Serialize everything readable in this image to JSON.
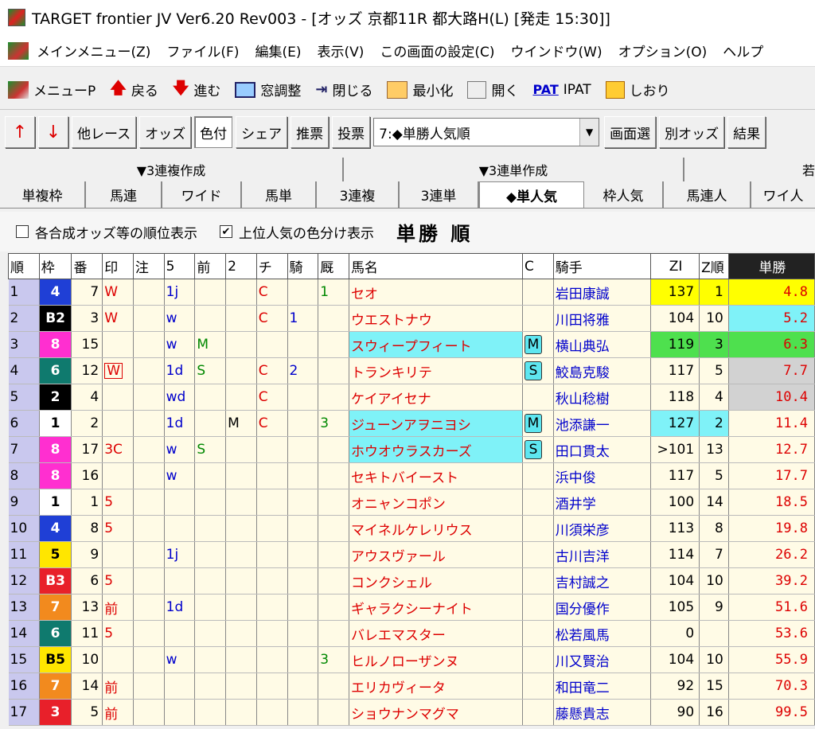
{
  "window": {
    "title": "TARGET frontier JV  Ver6.20  Rev003 - [オッズ 京都11R 都大路H(L) [発走 15:30]]"
  },
  "menu": [
    "メインメニュー(Z)",
    "ファイル(F)",
    "編集(E)",
    "表示(V)",
    "この画面の設定(C)",
    "ウインドウ(W)",
    "オプション(O)",
    "ヘルプ"
  ],
  "toolbar": {
    "items": [
      {
        "label": "メニューP",
        "icon": "menu-icon"
      },
      {
        "label": "戻る",
        "icon": "up-arrow-icon"
      },
      {
        "label": "進む",
        "icon": "down-arrow-icon"
      },
      {
        "label": "窓調整",
        "icon": "window-icon"
      },
      {
        "label": "閉じる",
        "icon": "close-icon"
      },
      {
        "label": "最小化",
        "icon": "minimize-icon"
      },
      {
        "label": "開く",
        "icon": "open-icon"
      },
      {
        "label": "IPAT",
        "icon": "pat-icon",
        "iconText": "PAT"
      },
      {
        "label": "しおり",
        "icon": "bookmark-icon"
      }
    ]
  },
  "toolbar2": {
    "up": "↑",
    "down": "↓",
    "buttons": [
      "他レース",
      "オッズ",
      "色付",
      "シェア",
      "推票",
      "投票"
    ],
    "pressed": "色付",
    "select": "7:◆単勝人気順",
    "right": [
      "画面選",
      "別オッズ",
      "結果"
    ]
  },
  "tabs_top": [
    {
      "label": "▼3連複作成"
    },
    {
      "label": "▼3連単作成"
    },
    {
      "label": "若"
    }
  ],
  "tabs": [
    "単複枠",
    "馬連",
    "ワイド",
    "馬単",
    "3連複",
    "3連単",
    "◆単人気",
    "枠人気",
    "馬連人",
    "ワイ人"
  ],
  "active_tab": "◆単人気",
  "options": {
    "rank_label": "各合成オッズ等の順位表示",
    "rank_checked": false,
    "color_label": "上位人気の色分け表示",
    "color_checked": true,
    "heading": "単勝 順"
  },
  "columns": [
    "順",
    "枠",
    "番",
    "印",
    "注",
    "5",
    "前",
    "2",
    "チ",
    "騎",
    "厩",
    "馬名",
    "C",
    "騎手",
    "ZI",
    "Z順",
    "単勝"
  ],
  "colors": {
    "waku": {
      "1": "#ffffff",
      "2": "#000000",
      "3": "#e8202a",
      "4": "#1f3fd6",
      "5": "#ffe600",
      "6": "#0f7a6e",
      "7": "#f28a1e",
      "8": "#ff2fd0"
    },
    "highlight_cyan": "#7ff2f8",
    "yellow": "#ffff00",
    "green": "#4ee04e",
    "gray": "#d2d2d2"
  },
  "rows": [
    {
      "rank": "1",
      "waku": "4",
      "wakuColor": "4",
      "num": "7",
      "mark": "W",
      "mark_cls": "red",
      "note": "",
      "f5": "1j",
      "mae": "",
      "f2": "",
      "chi": "C",
      "ki": "",
      "kyu": "1",
      "name": "セオ",
      "c": "",
      "jockey": "岩田康誠",
      "zi": "137",
      "zr": "1",
      "odds": "4.8",
      "nameBg": "",
      "ziBg": "yellow",
      "oddsBg": "yellow"
    },
    {
      "rank": "2",
      "waku": "B2",
      "wakuColor": "2",
      "num": "3",
      "mark": "W",
      "mark_cls": "red",
      "note": "",
      "f5": "w",
      "mae": "",
      "f2": "",
      "chi": "C",
      "ki": "1",
      "kyu": "",
      "name": "ウエストナウ",
      "c": "",
      "jockey": "川田将雅",
      "zi": "104",
      "zr": "10",
      "odds": "5.2",
      "nameBg": "",
      "ziBg": "",
      "oddsBg": "cyan"
    },
    {
      "rank": "3",
      "waku": "8",
      "wakuColor": "8",
      "num": "15",
      "mark": "",
      "mark_cls": "",
      "note": "",
      "f5": "w",
      "mae": "M",
      "f2": "",
      "chi": "",
      "ki": "",
      "kyu": "",
      "name": "スウィープフィート",
      "c": "M",
      "jockey": "横山典弘",
      "zi": "119",
      "zr": "3",
      "odds": "6.3",
      "nameBg": "cyan",
      "ziBg": "green",
      "oddsBg": "green"
    },
    {
      "rank": "4",
      "waku": "6",
      "wakuColor": "6",
      "num": "12",
      "mark": "W",
      "mark_cls": "box",
      "note": "",
      "f5": "1d",
      "mae": "S",
      "f2": "",
      "chi": "C",
      "ki": "2",
      "kyu": "",
      "name": "トランキリテ",
      "c": "S",
      "jockey": "鮫島克駿",
      "zi": "117",
      "zr": "5",
      "odds": "7.7",
      "nameBg": "",
      "ziBg": "",
      "oddsBg": "gray"
    },
    {
      "rank": "5",
      "waku": "2",
      "wakuColor": "2",
      "num": "4",
      "mark": "",
      "mark_cls": "",
      "note": "",
      "f5": "wd",
      "mae": "",
      "f2": "",
      "chi": "C",
      "ki": "",
      "kyu": "",
      "name": "ケイアイセナ",
      "c": "",
      "jockey": "秋山稔樹",
      "zi": "118",
      "zr": "4",
      "odds": "10.4",
      "nameBg": "",
      "ziBg": "",
      "oddsBg": "gray"
    },
    {
      "rank": "6",
      "waku": "1",
      "wakuColor": "1",
      "num": "2",
      "mark": "",
      "mark_cls": "",
      "note": "",
      "f5": "1d",
      "mae": "",
      "f2": "M",
      "chi": "C",
      "ki": "",
      "kyu": "3",
      "name": "ジューンアヲニヨシ",
      "c": "M",
      "jockey": "池添謙一",
      "zi": "127",
      "zr": "2",
      "odds": "11.4",
      "nameBg": "cyan",
      "ziBg": "cyan",
      "oddsBg": ""
    },
    {
      "rank": "7",
      "waku": "8",
      "wakuColor": "8",
      "num": "17",
      "mark": "3C",
      "mark_cls": "red",
      "note": "",
      "f5": "w",
      "mae": "S",
      "f2": "",
      "chi": "",
      "ki": "",
      "kyu": "",
      "name": "ホウオウラスカーズ",
      "c": "S",
      "jockey": "田口貫太",
      "zi": ">101",
      "zr": "13",
      "odds": "12.7",
      "nameBg": "cyan",
      "ziBg": "",
      "oddsBg": ""
    },
    {
      "rank": "8",
      "waku": "8",
      "wakuColor": "8",
      "num": "16",
      "mark": "",
      "mark_cls": "",
      "note": "",
      "f5": "w",
      "mae": "",
      "f2": "",
      "chi": "",
      "ki": "",
      "kyu": "",
      "name": "セキトバイースト",
      "c": "",
      "jockey": "浜中俊",
      "zi": "117",
      "zr": "5",
      "odds": "17.7",
      "nameBg": "",
      "ziBg": "",
      "oddsBg": ""
    },
    {
      "rank": "9",
      "waku": "1",
      "wakuColor": "1",
      "num": "1",
      "mark": "5",
      "mark_cls": "red",
      "note": "",
      "f5": "",
      "mae": "",
      "f2": "",
      "chi": "",
      "ki": "",
      "kyu": "",
      "name": "オニャンコポン",
      "c": "",
      "jockey": "酒井学",
      "zi": "100",
      "zr": "14",
      "odds": "18.5",
      "nameBg": "",
      "ziBg": "",
      "oddsBg": ""
    },
    {
      "rank": "10",
      "waku": "4",
      "wakuColor": "4",
      "num": "8",
      "mark": "5",
      "mark_cls": "red",
      "note": "",
      "f5": "",
      "mae": "",
      "f2": "",
      "chi": "",
      "ki": "",
      "kyu": "",
      "name": "マイネルケレリウス",
      "c": "",
      "jockey": "川須栄彦",
      "zi": "113",
      "zr": "8",
      "odds": "19.8",
      "nameBg": "",
      "ziBg": "",
      "oddsBg": ""
    },
    {
      "rank": "11",
      "waku": "5",
      "wakuColor": "5",
      "num": "9",
      "mark": "",
      "mark_cls": "",
      "note": "",
      "f5": "1j",
      "mae": "",
      "f2": "",
      "chi": "",
      "ki": "",
      "kyu": "",
      "name": "アウスヴァール",
      "c": "",
      "jockey": "古川吉洋",
      "zi": "114",
      "zr": "7",
      "odds": "26.2",
      "nameBg": "",
      "ziBg": "",
      "oddsBg": ""
    },
    {
      "rank": "12",
      "waku": "B3",
      "wakuColor": "3",
      "num": "6",
      "mark": "5",
      "mark_cls": "red",
      "note": "",
      "f5": "",
      "mae": "",
      "f2": "",
      "chi": "",
      "ki": "",
      "kyu": "",
      "name": "コンクシェル",
      "c": "",
      "jockey": "吉村誠之",
      "zi": "104",
      "zr": "10",
      "odds": "39.2",
      "nameBg": "",
      "ziBg": "",
      "oddsBg": ""
    },
    {
      "rank": "13",
      "waku": "7",
      "wakuColor": "7",
      "num": "13",
      "mark": "前",
      "mark_cls": "red",
      "note": "",
      "f5": "1d",
      "mae": "",
      "f2": "",
      "chi": "",
      "ki": "",
      "kyu": "",
      "name": "ギャラクシーナイト",
      "c": "",
      "jockey": "国分優作",
      "zi": "105",
      "zr": "9",
      "odds": "51.6",
      "nameBg": "",
      "ziBg": "",
      "oddsBg": ""
    },
    {
      "rank": "14",
      "waku": "6",
      "wakuColor": "6",
      "num": "11",
      "mark": "5",
      "mark_cls": "red",
      "note": "",
      "f5": "",
      "mae": "",
      "f2": "",
      "chi": "",
      "ki": "",
      "kyu": "",
      "name": "バレエマスター",
      "c": "",
      "jockey": "松若風馬",
      "zi": "0",
      "zr": "",
      "odds": "53.6",
      "nameBg": "",
      "ziBg": "",
      "oddsBg": ""
    },
    {
      "rank": "15",
      "waku": "B5",
      "wakuColor": "5",
      "num": "10",
      "mark": "",
      "mark_cls": "",
      "note": "",
      "f5": "w",
      "mae": "",
      "f2": "",
      "chi": "",
      "ki": "",
      "kyu": "3",
      "name": "ヒルノローザンヌ",
      "c": "",
      "jockey": "川又賢治",
      "zi": "104",
      "zr": "10",
      "odds": "55.9",
      "nameBg": "",
      "ziBg": "",
      "oddsBg": ""
    },
    {
      "rank": "16",
      "waku": "7",
      "wakuColor": "7",
      "num": "14",
      "mark": "前",
      "mark_cls": "red",
      "note": "",
      "f5": "",
      "mae": "",
      "f2": "",
      "chi": "",
      "ki": "",
      "kyu": "",
      "name": "エリカヴィータ",
      "c": "",
      "jockey": "和田竜二",
      "zi": "92",
      "zr": "15",
      "odds": "70.3",
      "nameBg": "",
      "ziBg": "",
      "oddsBg": ""
    },
    {
      "rank": "17",
      "waku": "3",
      "wakuColor": "3",
      "num": "5",
      "mark": "前",
      "mark_cls": "red",
      "note": "",
      "f5": "",
      "mae": "",
      "f2": "",
      "chi": "",
      "ki": "",
      "kyu": "",
      "name": "ショウナンマグマ",
      "c": "",
      "jockey": "藤懸貴志",
      "zi": "90",
      "zr": "16",
      "odds": "99.5",
      "nameBg": "",
      "ziBg": "",
      "oddsBg": ""
    }
  ]
}
